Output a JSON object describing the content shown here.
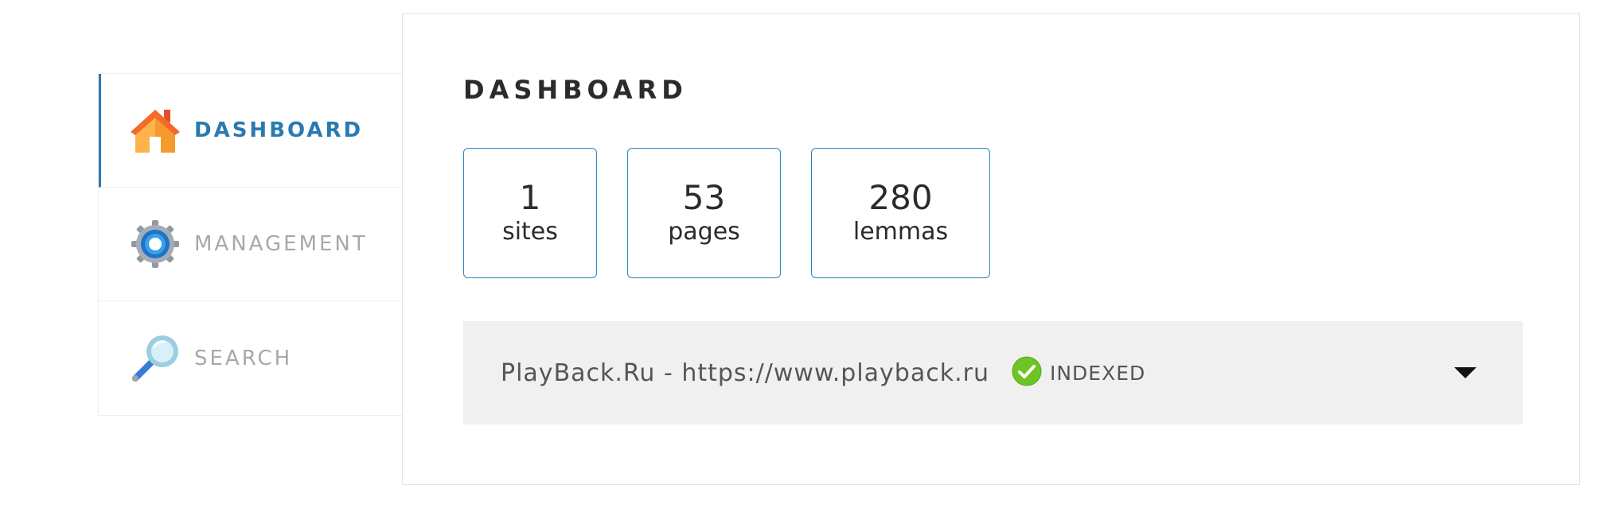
{
  "sidebar": {
    "items": [
      {
        "label": "DASHBOARD",
        "icon": "house-icon",
        "active": true
      },
      {
        "label": "MANAGEMENT",
        "icon": "gear-icon",
        "active": false
      },
      {
        "label": "SEARCH",
        "icon": "magnifier-icon",
        "active": false
      }
    ]
  },
  "main": {
    "title": "DASHBOARD",
    "stats": [
      {
        "value": "1",
        "label": "sites"
      },
      {
        "value": "53",
        "label": "pages"
      },
      {
        "value": "280",
        "label": "lemmas"
      }
    ],
    "sites": [
      {
        "name": "PlayBack.Ru - https://www.playback.ru",
        "status": "INDEXED",
        "status_icon": "check-circle-icon",
        "status_color": "#6cc524",
        "toggle_icon": "caret-down-icon"
      }
    ]
  },
  "colors": {
    "accent": "#2a7ab0",
    "stat_border": "#2a86b8",
    "inactive_nav": "#a8a8a8",
    "site_row_bg": "#f0f0f0"
  }
}
